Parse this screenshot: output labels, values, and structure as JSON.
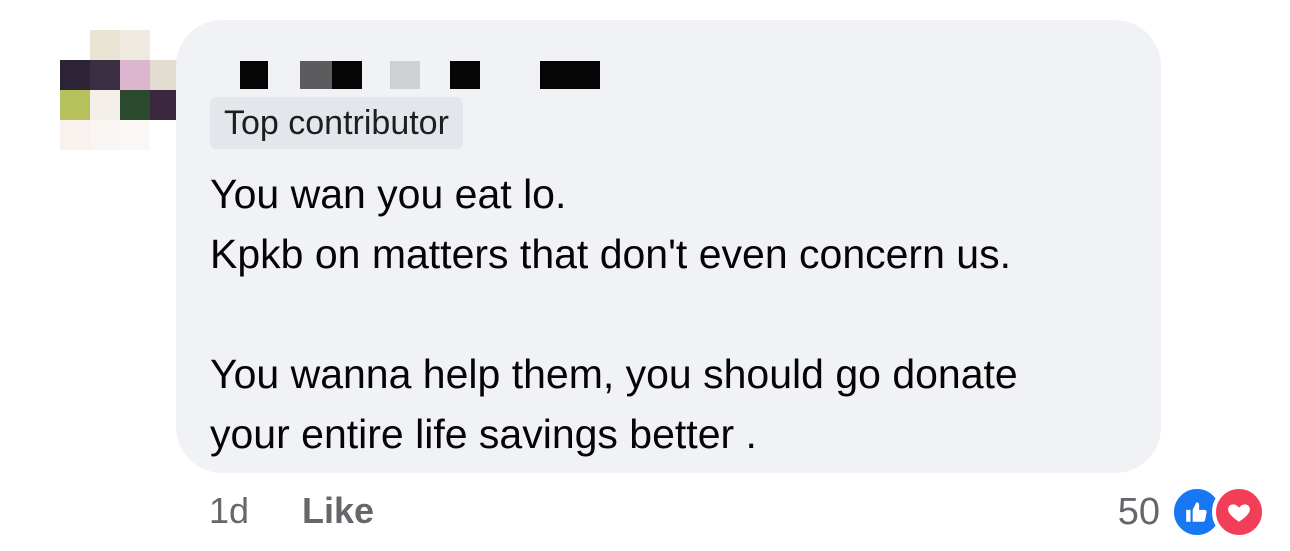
{
  "comment": {
    "badge": "Top contributor",
    "lines": [
      "You wan you eat lo.",
      "Kpkb on matters that don't even concern us.",
      "",
      "You wanna help them, you should go donate",
      "your entire life savings better ."
    ]
  },
  "meta": {
    "time": "1d",
    "like_label": "Like",
    "reaction_count": "50"
  },
  "icons": {
    "like": "thumbs-up-icon",
    "love": "heart-icon"
  },
  "colors": {
    "bubble_bg": "#f0f2f5",
    "badge_bg": "#e4e6eb",
    "text": "#050505",
    "meta_text": "#65676b",
    "like": "#1877f2",
    "love": "#f33e58"
  }
}
